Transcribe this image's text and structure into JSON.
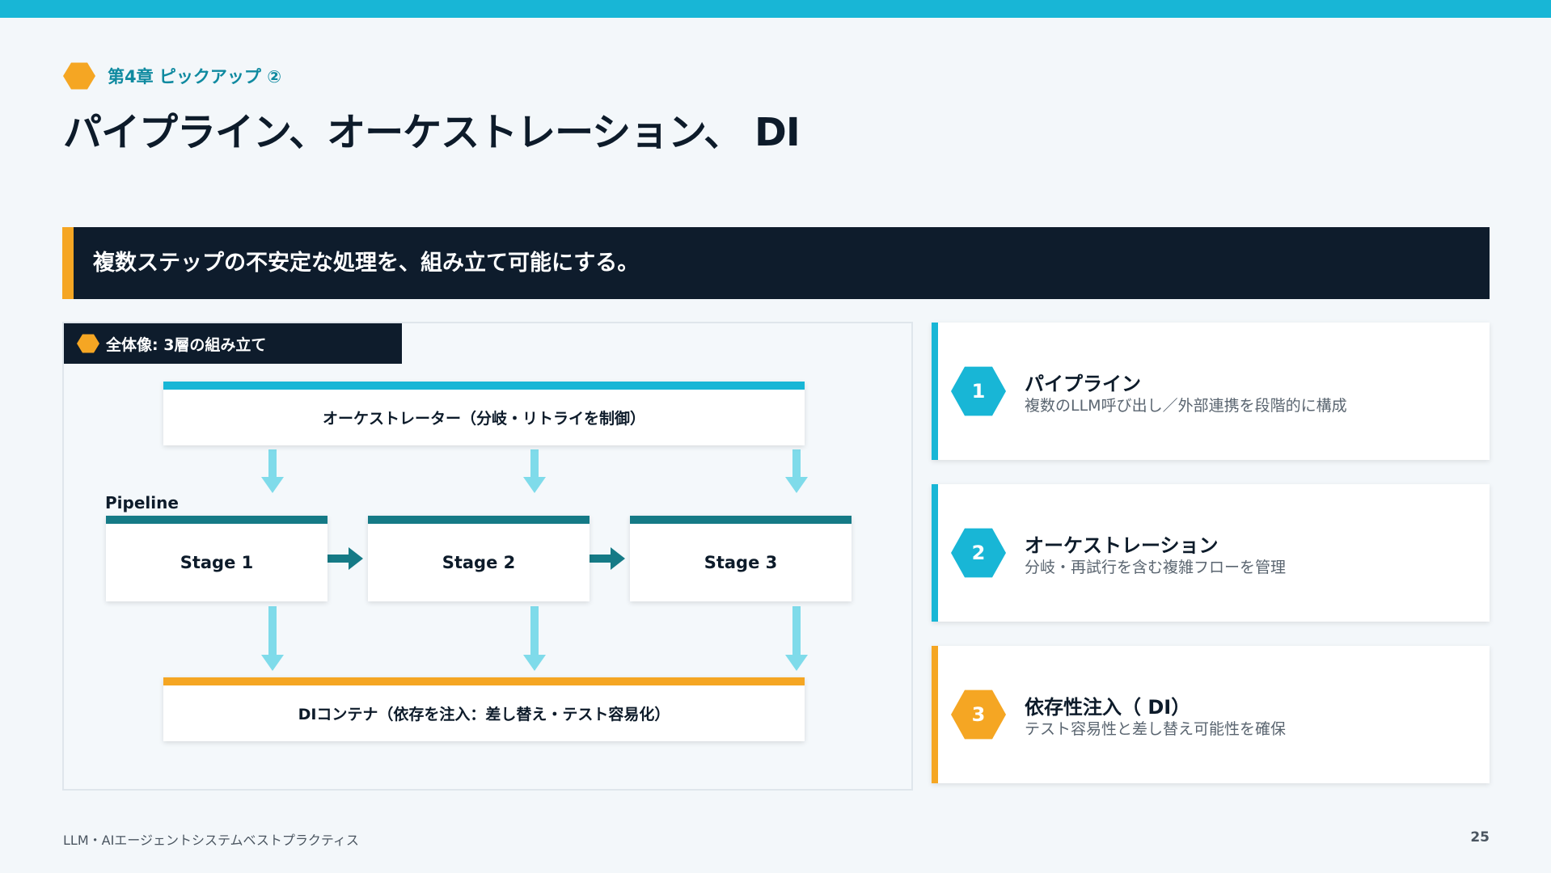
{
  "colors": {
    "top_bar": "#18b6d6",
    "accent_orange": "#f5a623",
    "accent_cyan": "#18b6d6",
    "dark_navy": "#0e1c2c",
    "stage_teal": "#157a86",
    "arrow_light": "#7fdbea",
    "arrow_dark": "#157a86"
  },
  "header": {
    "chapter_icon": "hexagon-icon",
    "chapter": "第4章 ピックアップ ②",
    "title": "パイプライン、オーケストレーション、 DI"
  },
  "banner": {
    "text": "複数ステップの不安定な処理を、組み立て可能にする。"
  },
  "diagram": {
    "label": "全体像: 3層の組み立て",
    "orchestrator": "オーケストレーター（分岐・リトライを制御）",
    "pipeline_label": "Pipeline",
    "stages": [
      "Stage 1",
      "Stage 2",
      "Stage 3"
    ],
    "di_container": "DIコンテナ（依存を注入：差し替え・テスト容易化）"
  },
  "cards": [
    {
      "number": "1",
      "title": "パイプライン",
      "desc": "複数のLLM呼び出し／外部連携を段階的に構成"
    },
    {
      "number": "2",
      "title": "オーケストレーション",
      "desc": "分岐・再試行を含む複雑フローを管理"
    },
    {
      "number": "3",
      "title": "依存性注入（ DI）",
      "desc": "テスト容易性と差し替え可能性を確保"
    }
  ],
  "footer": {
    "text": "LLM・AIエージェントシステムベストプラクティス",
    "page": "25"
  }
}
